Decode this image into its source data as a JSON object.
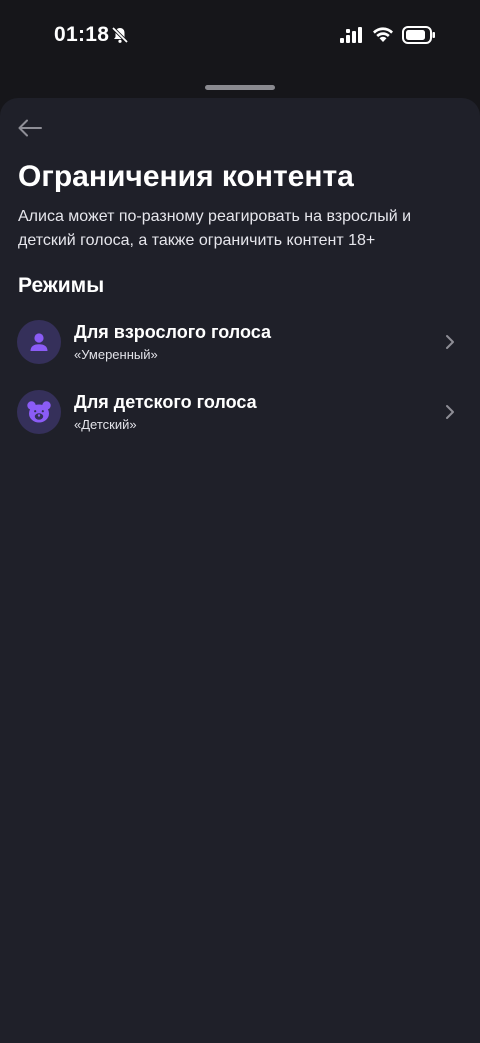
{
  "status_bar": {
    "time": "01:18",
    "icons": [
      "bell-slash-icon",
      "signal-icon",
      "wifi-icon",
      "battery-icon"
    ]
  },
  "header": {
    "back_icon": "arrow-left-icon",
    "title": "Ограничения контента",
    "description": "Алиса может по-разному реагировать на взрослый и детский голоса, а также ограничить контент 18+"
  },
  "modes": {
    "section_title": "Режимы",
    "items": [
      {
        "title": "Для взрослого голоса",
        "value": "«Умеренный»",
        "icon": "person-icon"
      },
      {
        "title": "Для детского голоса",
        "value": "«Детский»",
        "icon": "bear-icon"
      }
    ]
  },
  "colors": {
    "background": "#1f2029",
    "icon_bg": "#35305a",
    "icon_accent": "#8b5cf6"
  }
}
